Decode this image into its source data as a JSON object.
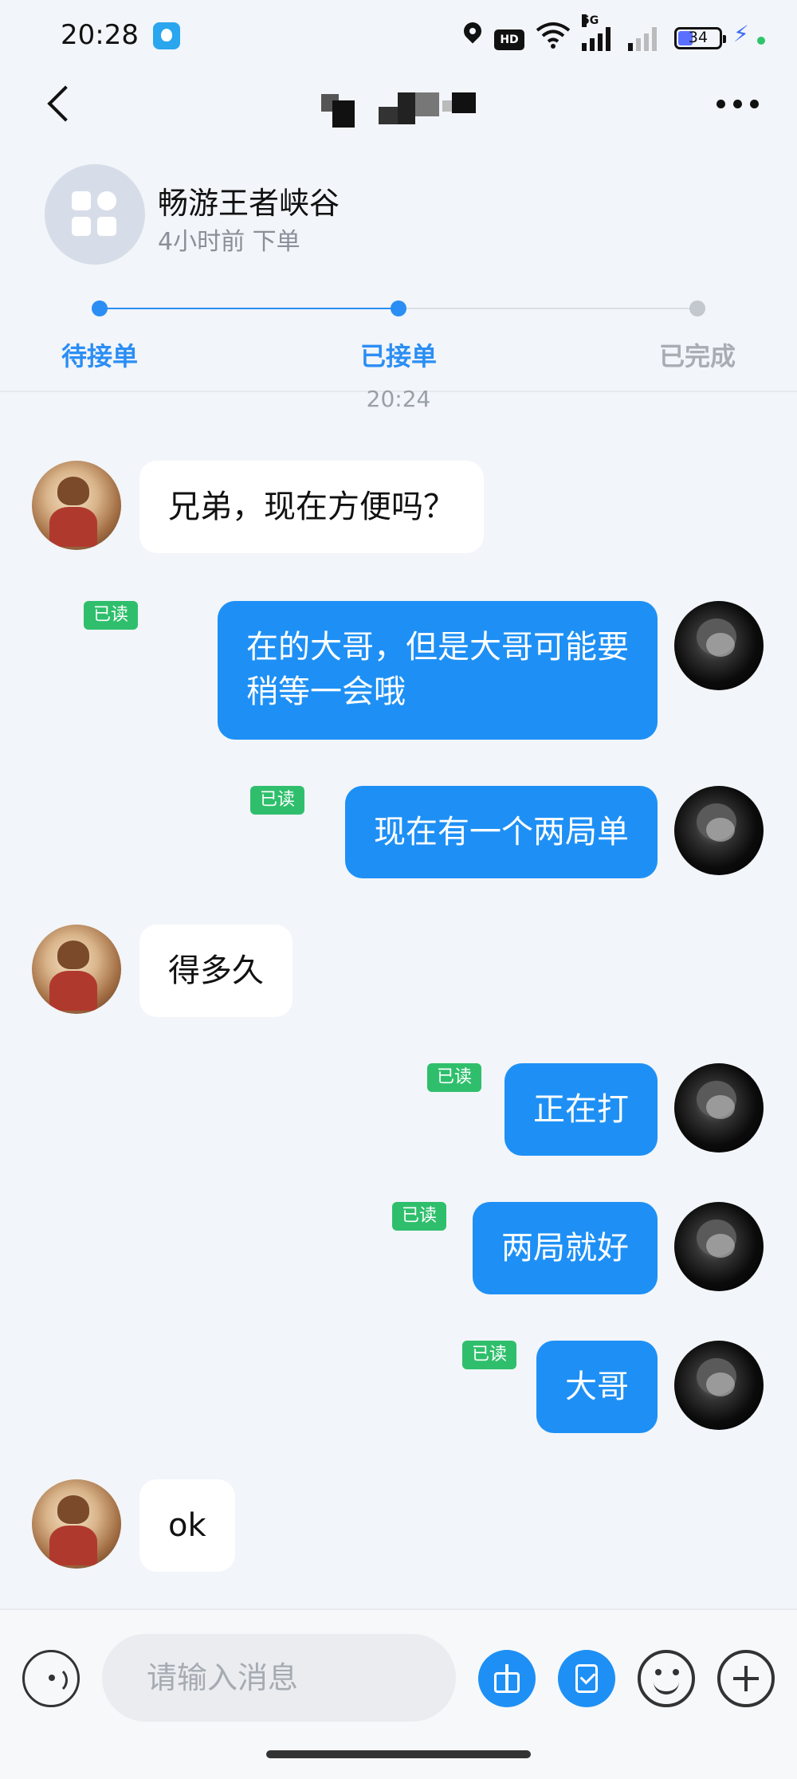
{
  "status_bar": {
    "time": "20:28",
    "hd_label": "HD",
    "network_label": "5G",
    "battery": "34",
    "icons": [
      "app-icon",
      "location-icon",
      "hd-icon",
      "wifi-icon",
      "signal-icon",
      "signal-weak-icon",
      "battery-icon",
      "charging-icon"
    ]
  },
  "nav": {
    "title_note": "",
    "back_icon": "back-chevron-icon",
    "more_icon": "more-dots-icon"
  },
  "order": {
    "title": "畅游王者峡谷",
    "subtitle": "4小时前 下单",
    "steps": [
      {
        "label": "待接单",
        "state": "done"
      },
      {
        "label": "已接单",
        "state": "done"
      },
      {
        "label": "已完成",
        "state": "pending"
      }
    ],
    "colors": {
      "active": "#2b8ef4",
      "inactive": "#a8adb5"
    }
  },
  "chat": {
    "time_separator": "20:24",
    "read_label": "已读",
    "messages": [
      {
        "from": "other",
        "lines": [
          "兄弟，现在方便吗？"
        ]
      },
      {
        "from": "me",
        "read": true,
        "lines": [
          "在的大哥，但是大哥可能要",
          "稍等一会哦"
        ]
      },
      {
        "from": "me",
        "read": true,
        "lines": [
          "现在有一个两局单"
        ]
      },
      {
        "from": "other",
        "lines": [
          "得多久"
        ]
      },
      {
        "from": "me",
        "read": true,
        "lines": [
          "正在打"
        ]
      },
      {
        "from": "me",
        "read": true,
        "lines": [
          "两局就好"
        ]
      },
      {
        "from": "me",
        "read": true,
        "lines": [
          "大哥"
        ]
      },
      {
        "from": "other",
        "lines": [
          "ok"
        ]
      }
    ]
  },
  "input_bar": {
    "placeholder": "请输入消息",
    "icons": [
      "voice-icon",
      "gift-icon",
      "coupon-icon",
      "emoji-icon",
      "plus-icon"
    ]
  },
  "colors": {
    "background": "#f2f5f9",
    "my_bubble": "#1e90f5",
    "other_bubble": "#ffffff",
    "read_badge": "#2fbf6c"
  }
}
